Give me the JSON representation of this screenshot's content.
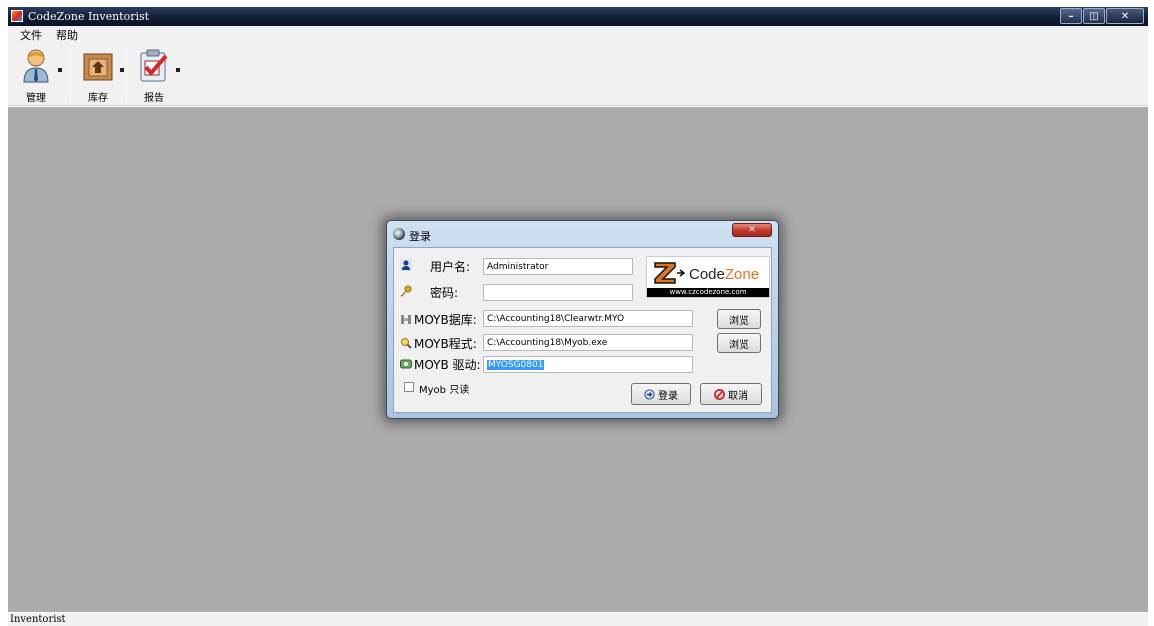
{
  "window": {
    "title": "CodeZone Inventorist"
  },
  "menu": {
    "file": "文件",
    "help": "帮助"
  },
  "toolbar": {
    "manage": "管理",
    "stock": "库存",
    "report": "报告"
  },
  "status": {
    "text": "Inventorist"
  },
  "dialog": {
    "title": "登录",
    "username_label": "用户名:",
    "username_value": "Administrator",
    "password_label": "密码:",
    "password_value": "",
    "db_label": "MOYB据库:",
    "db_value": "C:\\Accounting18\\Clearwtr.MYO",
    "program_label": "MOYB程式:",
    "program_value": "C:\\Accounting18\\Myob.exe",
    "driver_label": "MOYB 驱动:",
    "driver_value": "MYOSG0801",
    "browse_label": "浏览",
    "readonly_label": "Myob 只读",
    "login_button": "登录",
    "cancel_button": "取消",
    "logo_brand_a": "Code",
    "logo_brand_b": "Zone",
    "logo_url": "www.czcodezone.com"
  },
  "colors": {
    "workspace": "#ababab",
    "titlebar": "#0e1b31",
    "accent": "#e2731d"
  }
}
